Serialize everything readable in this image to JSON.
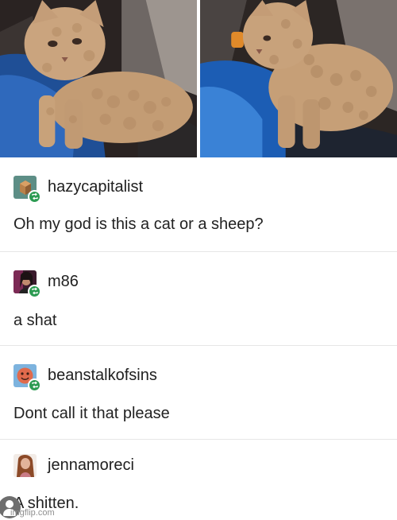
{
  "posts": [
    {
      "username": "hazycapitalist",
      "message": "Oh my god is this a cat or a sheep?",
      "avatar_icon": "cube-avatar-icon"
    },
    {
      "username": "m86",
      "message": "a shat",
      "avatar_icon": "person-photo-avatar-icon"
    },
    {
      "username": "beanstalkofsins",
      "message": "Dont call it that please",
      "avatar_icon": "smiley-avatar-icon"
    },
    {
      "username": "jennamoreci",
      "message": "A shitten.",
      "avatar_icon": "person-photo-avatar-icon"
    }
  ],
  "watermark": {
    "text": "imgflip.com"
  },
  "colors": {
    "reblog_badge": "#2c9b52",
    "background": "#ffffff",
    "divider": "#e6e6e6"
  }
}
